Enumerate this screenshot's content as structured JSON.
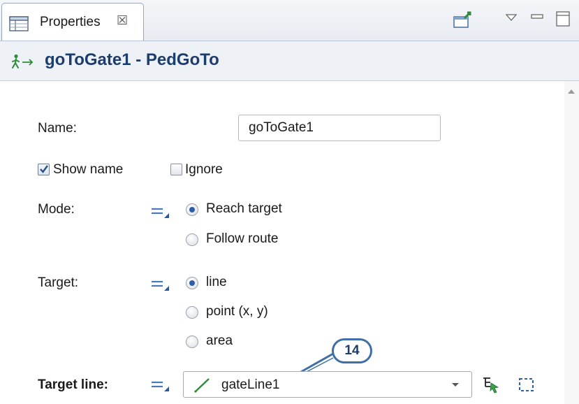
{
  "tab": {
    "label": "Properties",
    "close_glyph": "☒"
  },
  "toolbar": {
    "icons": [
      "pin-to-element-icon",
      "view-menu-icon",
      "minimize-icon",
      "maximize-icon"
    ]
  },
  "header": {
    "title": "goToGate1 - PedGoTo",
    "icon": "pedestrian-goto-icon"
  },
  "form": {
    "name": {
      "label": "Name:",
      "value": "goToGate1"
    },
    "show_name": {
      "label": "Show name",
      "checked": true
    },
    "ignore": {
      "label": "Ignore",
      "checked": false
    },
    "mode": {
      "label": "Mode:",
      "options": [
        {
          "label": "Reach target",
          "selected": true
        },
        {
          "label": "Follow route",
          "selected": false
        }
      ]
    },
    "target": {
      "label": "Target:",
      "options": [
        {
          "label": "line",
          "selected": true
        },
        {
          "label": "point (x, y)",
          "selected": false
        },
        {
          "label": "area",
          "selected": false
        }
      ]
    },
    "target_line": {
      "label": "Target line:",
      "value": "gateLine1"
    }
  },
  "callout": {
    "number": "14"
  },
  "colors": {
    "header_title": "#1d3d6c",
    "accent_blue": "#2d5fa8",
    "callout_border": "#3f6fa5"
  }
}
